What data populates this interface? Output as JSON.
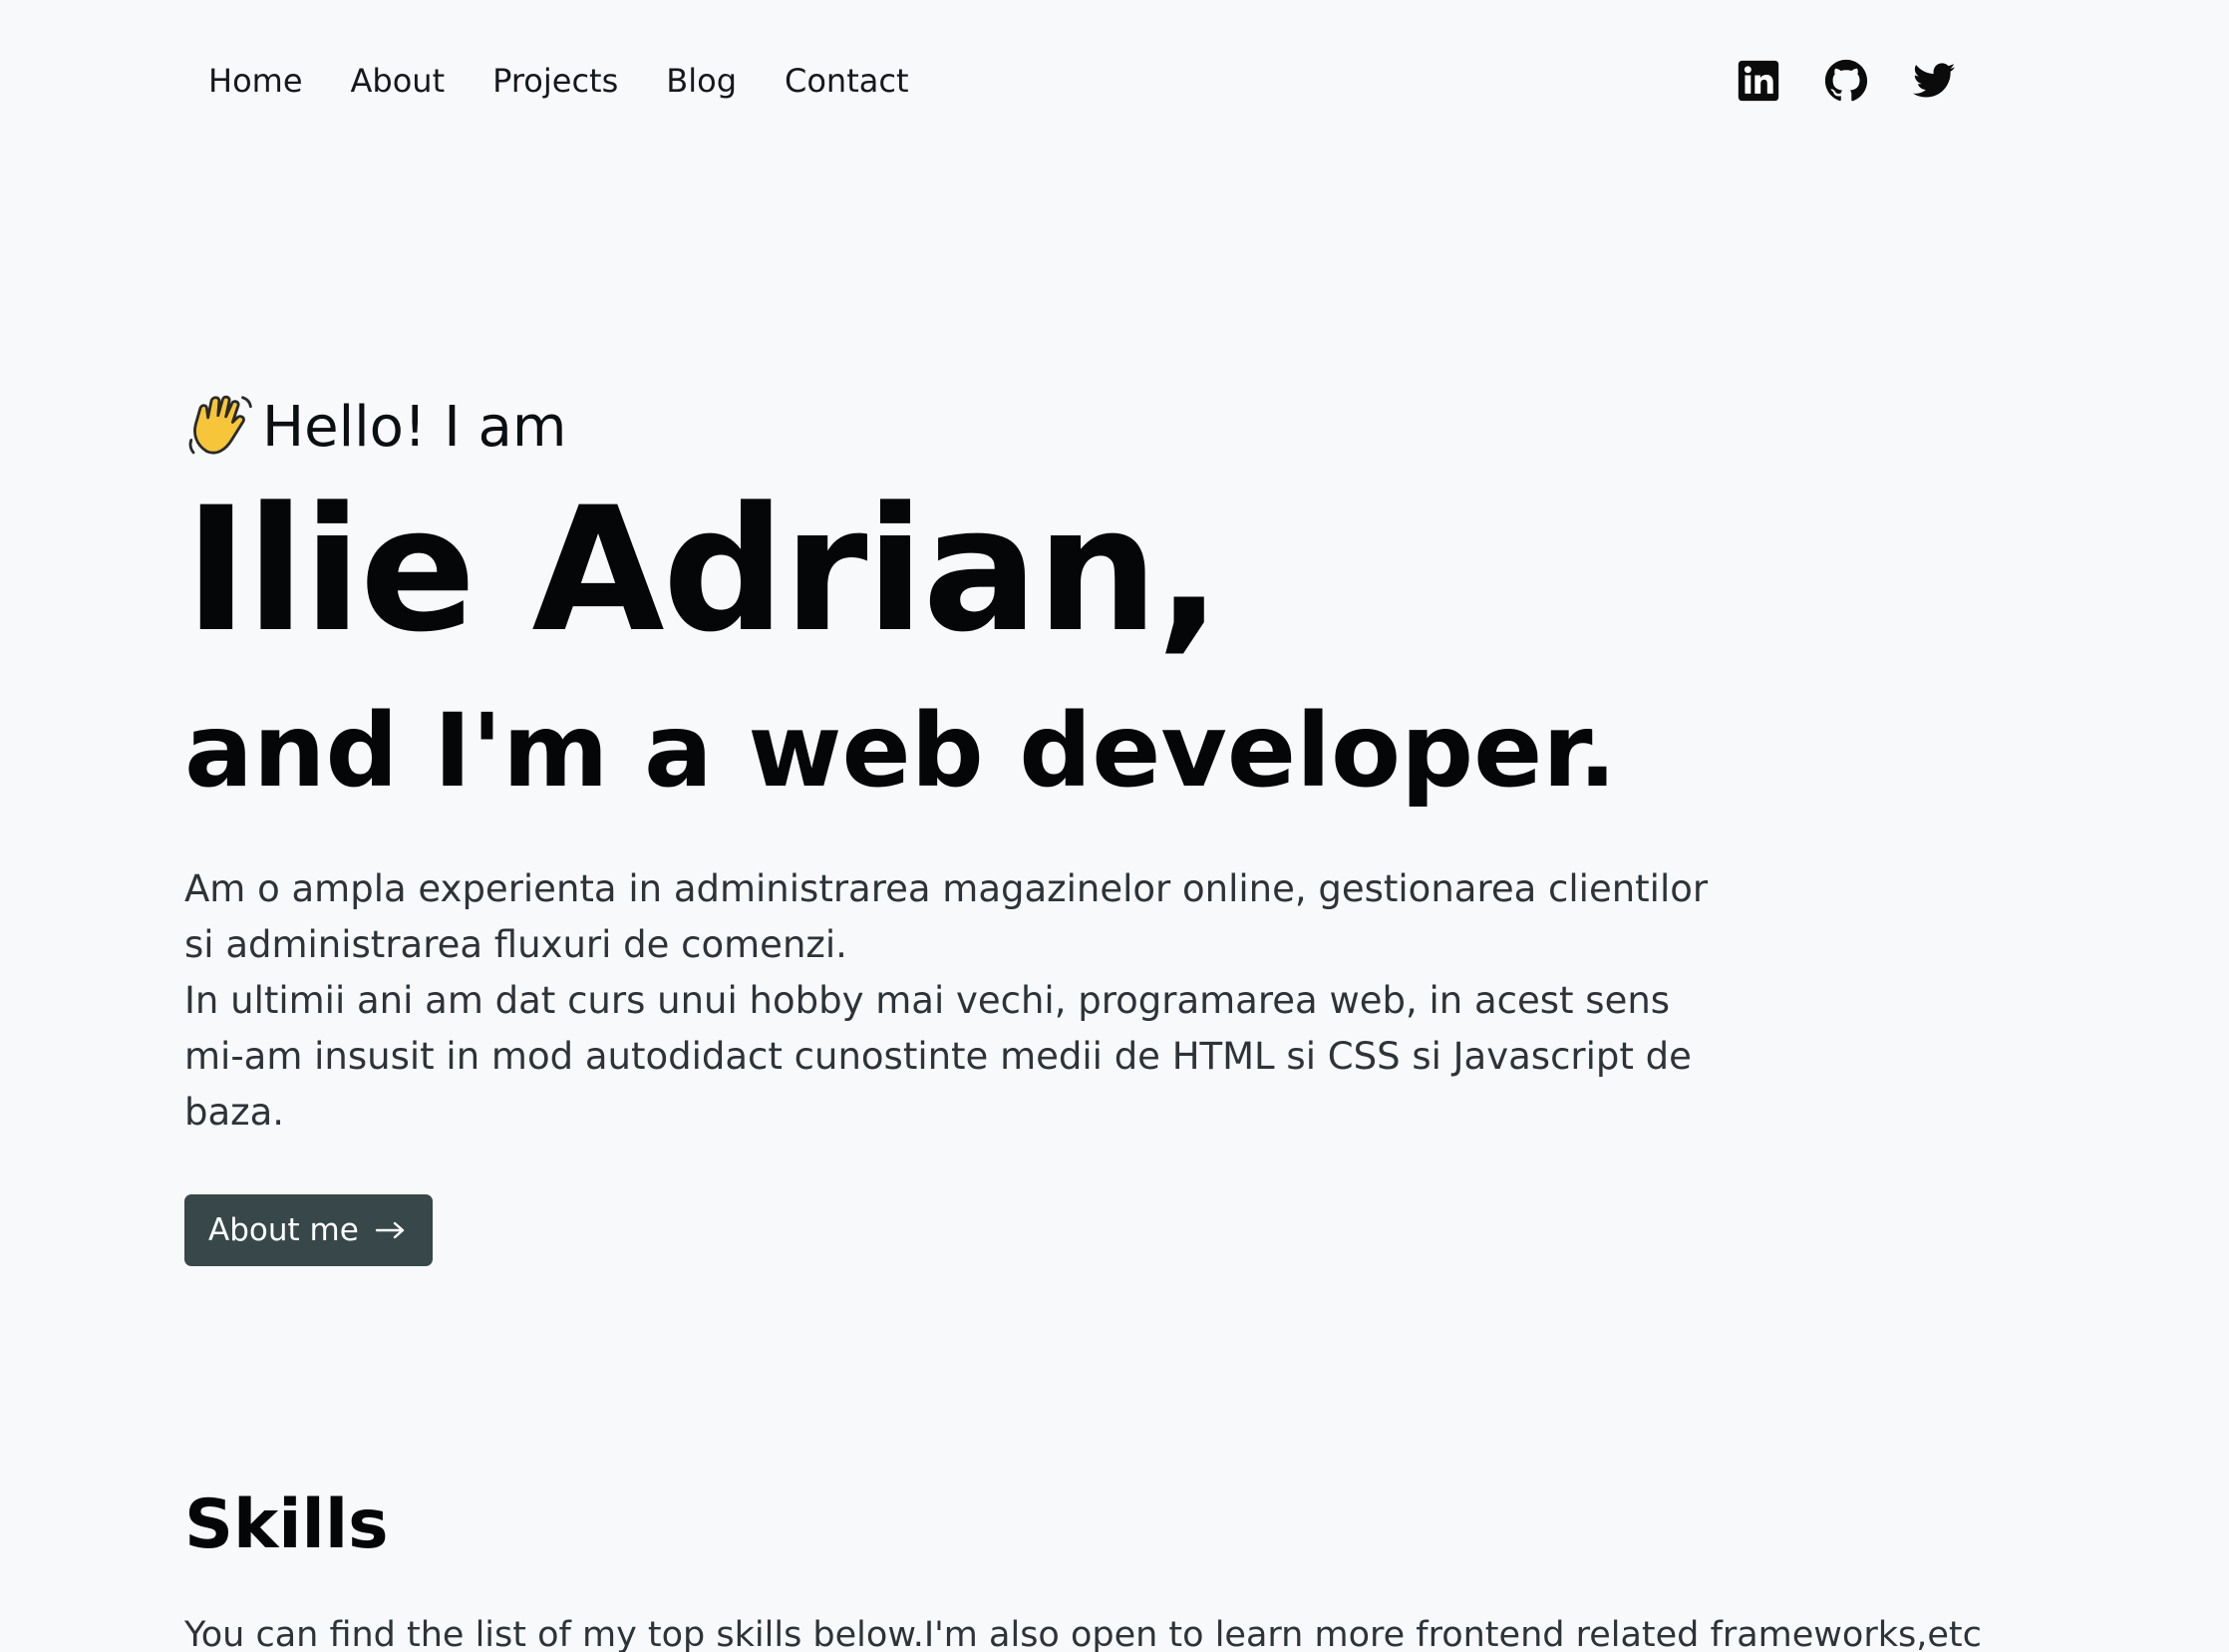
{
  "nav": {
    "items": [
      {
        "label": "Home"
      },
      {
        "label": "About"
      },
      {
        "label": "Projects"
      },
      {
        "label": "Blog"
      },
      {
        "label": "Contact"
      }
    ]
  },
  "social": {
    "icons": [
      "linkedin-icon",
      "github-icon",
      "twitter-icon"
    ]
  },
  "hero": {
    "greeting": "Hello! I am",
    "wave_icon": "waving-hand-icon",
    "name": "Ilie Adrian,",
    "subtitle": "and I'm a web developer.",
    "bio": [
      "Am o ampla experienta in administrarea magazinelor online, gestionarea clientilor si administrarea fluxuri de comenzi.",
      "In ultimii ani am dat curs unui hobby mai vechi, programarea web, in acest sens mi-am insusit in mod autodidact cunostinte medii de HTML si CSS si Javascript de baza."
    ],
    "cta_label": "About me",
    "cta_icon": "arrow-right-icon"
  },
  "skills": {
    "title": "Skills",
    "description": "You can find the list of my top skills below.I'm also open to learn more frontend related frameworks,etc"
  },
  "colors": {
    "background": "#f8f9fb",
    "button": "#37474a",
    "text": "#050607"
  }
}
